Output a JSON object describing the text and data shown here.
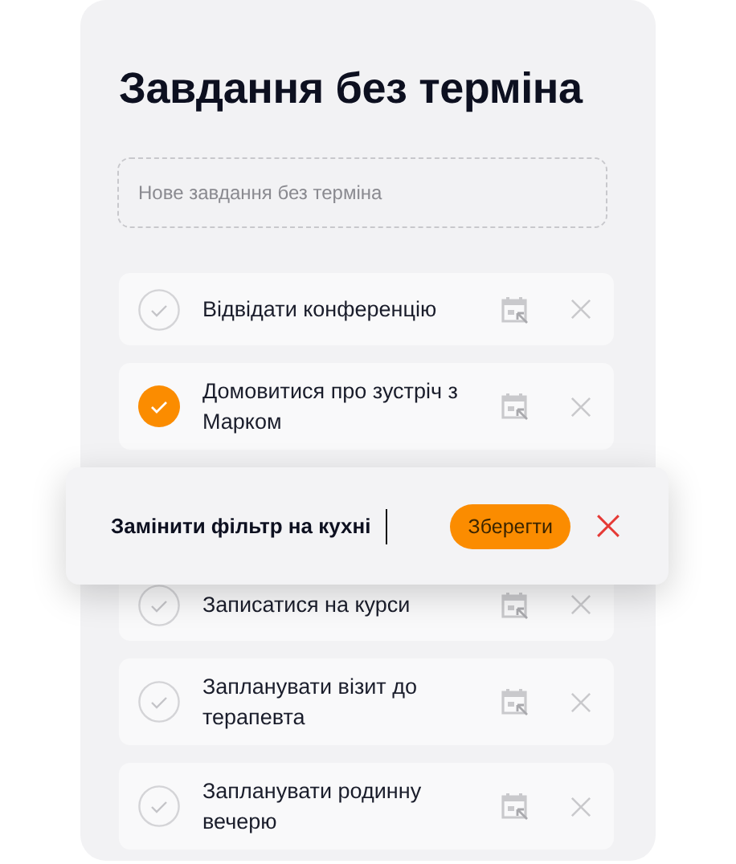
{
  "title": "Завдання без терміна",
  "new_task": {
    "placeholder": "Нове завдання без терміна"
  },
  "tasks": [
    {
      "kind": "task",
      "text": "Відвідати конференцію",
      "checked": false
    },
    {
      "kind": "task",
      "text": "Домовитися про зустріч з Марком",
      "checked": true
    },
    {
      "kind": "edit",
      "value": "Замінити фільтр на кухні",
      "save": "Зберегти"
    },
    {
      "kind": "task",
      "text": "Записатися на курси",
      "checked": false
    },
    {
      "kind": "task",
      "text": "Запланувати візит до терапевта",
      "checked": false
    },
    {
      "kind": "task",
      "text": "Запланувати родинну вечерю",
      "checked": false
    }
  ]
}
